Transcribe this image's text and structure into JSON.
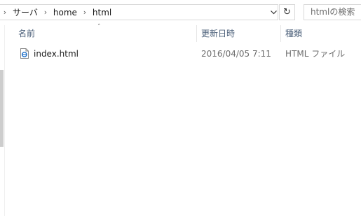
{
  "address_bar": {
    "breadcrumbs": [
      "サーバ",
      "home",
      "html"
    ],
    "search_placeholder": "htmlの検索"
  },
  "columns": {
    "name": "名前",
    "date": "更新日時",
    "type": "種類"
  },
  "files": [
    {
      "name": "index.html",
      "date": "2016/04/05 7:11",
      "type": "HTML ファイル",
      "icon": "html-file-icon"
    }
  ],
  "colors": {
    "header_text": "#4c607a",
    "meta_text": "#6d6d6d",
    "icon_blue": "#1e6fc8"
  }
}
